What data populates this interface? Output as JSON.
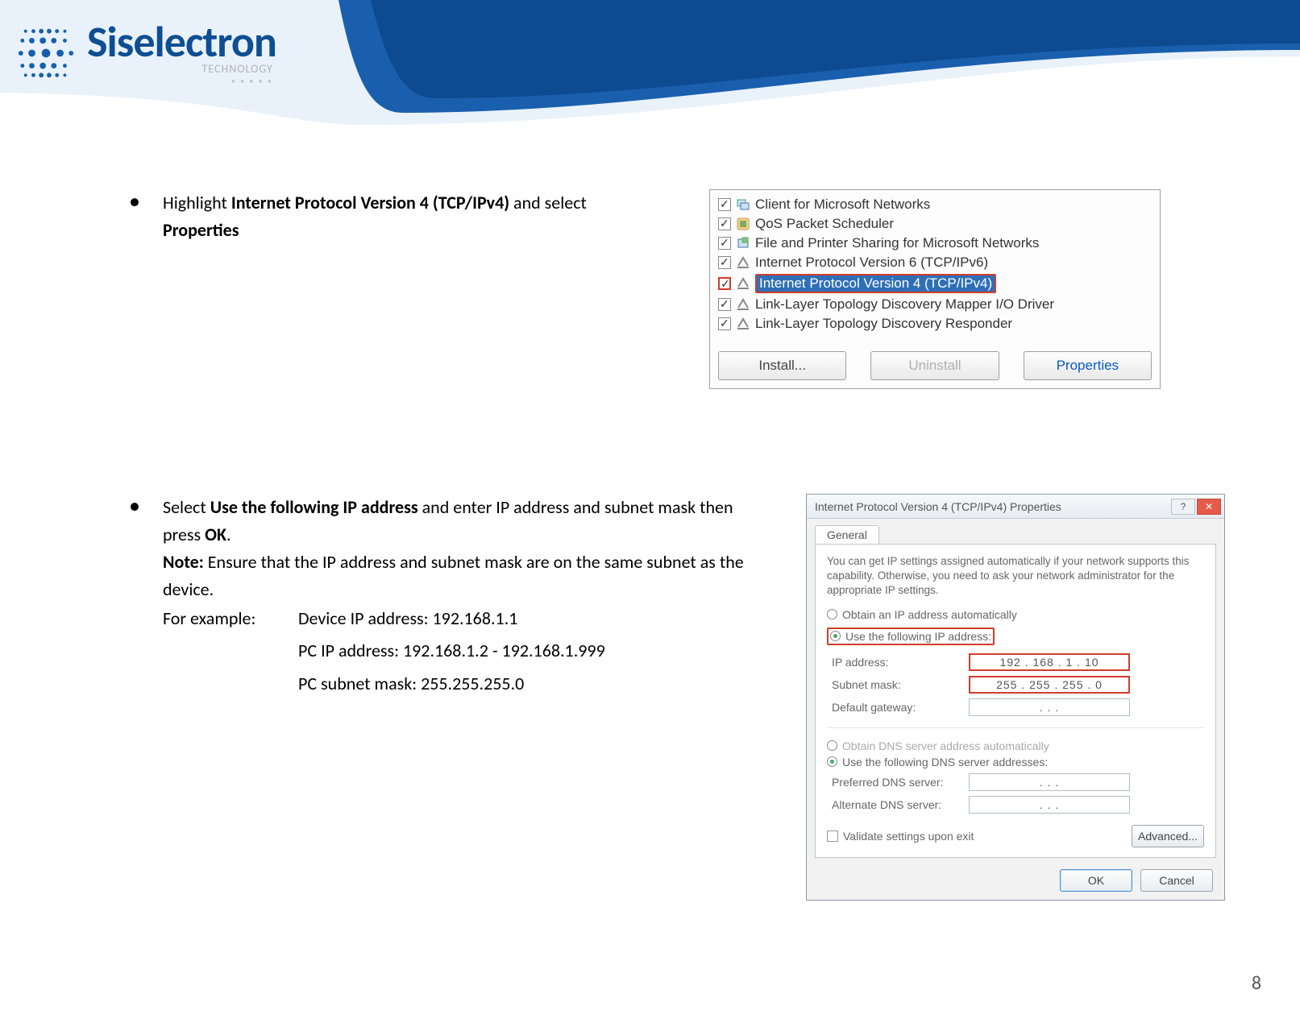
{
  "brand": {
    "name": "Siselectron",
    "subtitle": "TECHNOLOGY"
  },
  "page_number": "8",
  "step1": {
    "text_pre": "Highlight ",
    "bold1": "Internet Protocol Version 4 (TCP/IPv4)",
    "text_mid": " and select ",
    "bold2": "Properties"
  },
  "net_list": {
    "items": [
      "Client for Microsoft Networks",
      "QoS Packet Scheduler",
      "File and Printer Sharing for Microsoft Networks",
      "Internet Protocol Version 6 (TCP/IPv6)",
      "Internet Protocol Version 4 (TCP/IPv4)",
      "Link-Layer Topology Discovery Mapper I/O Driver",
      "Link-Layer Topology Discovery Responder"
    ],
    "install_btn": "Install...",
    "uninstall_btn": "Uninstall",
    "properties_btn": "Properties"
  },
  "step2": {
    "line1_pre": "Select ",
    "line1_bold": "Use the following IP address",
    "line1_post": " and enter IP address and subnet mask then press ",
    "line1_bold2": "OK",
    "line1_end": ".",
    "note_label": "Note:",
    "note_text": " Ensure that the IP address and subnet mask are on the same subnet as the device.",
    "example_label": "For example:",
    "example_lines": [
      "Device IP address: 192.168.1.1",
      "PC IP address: 192.168.1.2 - 192.168.1.999",
      "PC subnet mask: 255.255.255.0"
    ]
  },
  "ipv4_dialog": {
    "title": "Internet Protocol Version 4 (TCP/IPv4) Properties",
    "tab": "General",
    "desc": "You can get IP settings assigned automatically if your network supports this capability. Otherwise, you need to ask your network administrator for the appropriate IP settings.",
    "radio_auto_ip": "Obtain an IP address automatically",
    "radio_static_ip": "Use the following IP address:",
    "ip_label": "IP address:",
    "ip_value": "192 . 168 .  1  . 10",
    "mask_label": "Subnet mask:",
    "mask_value": "255 . 255 . 255 .  0",
    "gw_label": "Default gateway:",
    "gw_value": ".      .      .",
    "radio_auto_dns": "Obtain DNS server address automatically",
    "radio_static_dns": "Use the following DNS server addresses:",
    "pref_dns_label": "Preferred DNS server:",
    "pref_dns_value": ".      .      .",
    "alt_dns_label": "Alternate DNS server:",
    "alt_dns_value": ".      .      .",
    "validate_label": "Validate settings upon exit",
    "advanced_btn": "Advanced...",
    "ok_btn": "OK",
    "cancel_btn": "Cancel"
  }
}
